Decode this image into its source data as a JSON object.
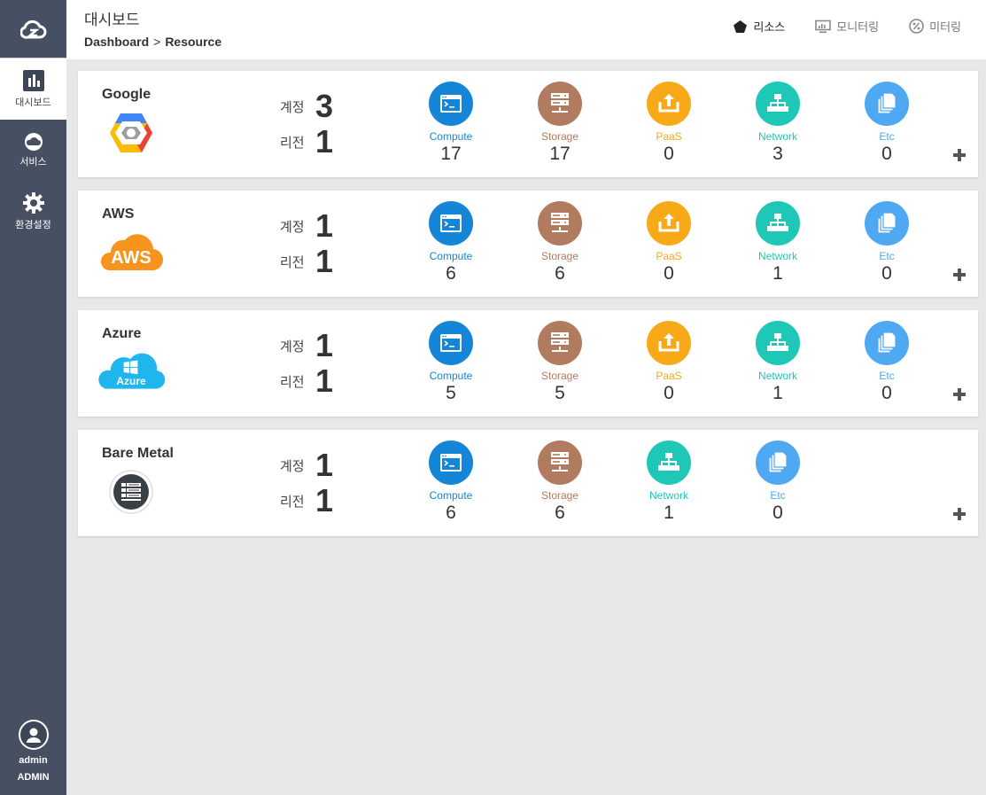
{
  "sidebar": {
    "logo": "cloud-logo",
    "items": [
      {
        "label": "대시보드",
        "icon": "bar-chart-icon",
        "active": true
      },
      {
        "label": "서비스",
        "icon": "cloud-icon",
        "active": false
      },
      {
        "label": "환경설정",
        "icon": "gear-icon",
        "active": false
      }
    ],
    "user": {
      "name": "admin",
      "role": "ADMIN"
    }
  },
  "header": {
    "title": "대시보드",
    "breadcrumb": [
      "Dashboard",
      "Resource"
    ],
    "breadcrumb_sep": ">",
    "tabs": [
      {
        "label": "리소스",
        "icon": "pentagon-icon",
        "active": true
      },
      {
        "label": "모니터링",
        "icon": "monitor-icon",
        "active": false
      },
      {
        "label": "미터링",
        "icon": "percent-icon",
        "active": false
      }
    ]
  },
  "labels": {
    "account": "계정",
    "region": "리전"
  },
  "colors": {
    "compute": "#1585d8",
    "storage": "#b07b5e",
    "paas": "#f7a918",
    "network": "#1ec7b6",
    "etc": "#4fa8f2",
    "sidebar": "#465062"
  },
  "providers": [
    {
      "name": "Google",
      "logo": "google-cloud-logo",
      "account": "3",
      "region": "1",
      "resources": [
        {
          "key": "compute",
          "label": "Compute",
          "value": "17"
        },
        {
          "key": "storage",
          "label": "Storage",
          "value": "17"
        },
        {
          "key": "paas",
          "label": "PaaS",
          "value": "0"
        },
        {
          "key": "network",
          "label": "Network",
          "value": "3"
        },
        {
          "key": "etc",
          "label": "Etc",
          "value": "0"
        }
      ]
    },
    {
      "name": "AWS",
      "logo": "aws-logo",
      "logo_text": "AWS",
      "account": "1",
      "region": "1",
      "resources": [
        {
          "key": "compute",
          "label": "Compute",
          "value": "6"
        },
        {
          "key": "storage",
          "label": "Storage",
          "value": "6"
        },
        {
          "key": "paas",
          "label": "PaaS",
          "value": "0"
        },
        {
          "key": "network",
          "label": "Network",
          "value": "1"
        },
        {
          "key": "etc",
          "label": "Etc",
          "value": "0"
        }
      ]
    },
    {
      "name": "Azure",
      "logo": "azure-logo",
      "logo_text": "Azure",
      "account": "1",
      "region": "1",
      "resources": [
        {
          "key": "compute",
          "label": "Compute",
          "value": "5"
        },
        {
          "key": "storage",
          "label": "Storage",
          "value": "5"
        },
        {
          "key": "paas",
          "label": "PaaS",
          "value": "0"
        },
        {
          "key": "network",
          "label": "Network",
          "value": "1"
        },
        {
          "key": "etc",
          "label": "Etc",
          "value": "0"
        }
      ]
    },
    {
      "name": "Bare Metal",
      "logo": "bare-metal-logo",
      "account": "1",
      "region": "1",
      "resources": [
        {
          "key": "compute",
          "label": "Compute",
          "value": "6"
        },
        {
          "key": "storage",
          "label": "Storage",
          "value": "6"
        },
        {
          "key": "network",
          "label": "Network",
          "value": "1"
        },
        {
          "key": "etc",
          "label": "Etc",
          "value": "0"
        }
      ]
    }
  ]
}
